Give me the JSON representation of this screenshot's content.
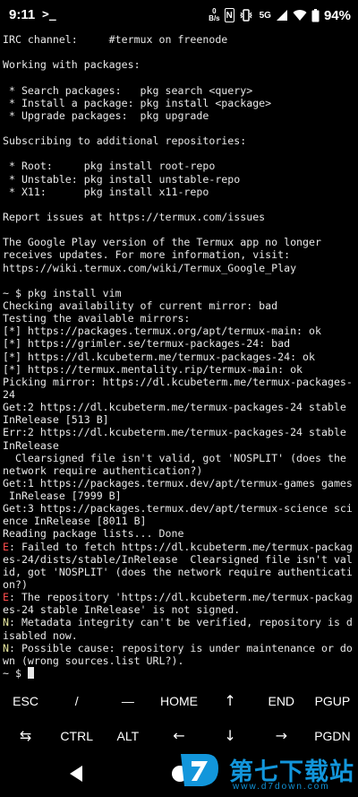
{
  "status_bar": {
    "time": "9:11",
    "terminal_icon": ">_",
    "net_speed_value": "0",
    "net_speed_unit": "B/s",
    "nfc_label": "N",
    "network_label": "5G",
    "battery_text": "94%"
  },
  "terminal": {
    "lines": [
      {
        "text": "IRC channel:     #termux on freenode"
      },
      {
        "text": ""
      },
      {
        "text": "Working with packages:"
      },
      {
        "text": ""
      },
      {
        "text": " * Search packages:   pkg search <query>"
      },
      {
        "text": " * Install a package: pkg install <package>"
      },
      {
        "text": " * Upgrade packages:  pkg upgrade"
      },
      {
        "text": ""
      },
      {
        "text": "Subscribing to additional repositories:"
      },
      {
        "text": ""
      },
      {
        "text": " * Root:     pkg install root-repo"
      },
      {
        "text": " * Unstable: pkg install unstable-repo"
      },
      {
        "text": " * X11:      pkg install x11-repo"
      },
      {
        "text": ""
      },
      {
        "text": "Report issues at https://termux.com/issues"
      },
      {
        "text": ""
      },
      {
        "text": "The Google Play version of the Termux app no longer"
      },
      {
        "text": "receives updates. For more information, visit:"
      },
      {
        "text": "https://wiki.termux.com/wiki/Termux_Google_Play"
      },
      {
        "text": ""
      },
      {
        "text": "~ $ pkg install vim"
      },
      {
        "text": "Checking availability of current mirror: bad"
      },
      {
        "text": "Testing the available mirrors:"
      },
      {
        "text": "[*] https://packages.termux.org/apt/termux-main: ok"
      },
      {
        "text": "[*] https://grimler.se/termux-packages-24: bad"
      },
      {
        "text": "[*] https://dl.kcubeterm.me/termux-packages-24: ok"
      },
      {
        "text": "[*] https://termux.mentality.rip/termux-main: ok"
      },
      {
        "text": "Picking mirror: https://dl.kcubeterm.me/termux-packages-"
      },
      {
        "text": "24"
      },
      {
        "text": "Get:2 https://dl.kcubeterm.me/termux-packages-24 stable"
      },
      {
        "text": "InRelease [513 B]"
      },
      {
        "text": "Err:2 https://dl.kcubeterm.me/termux-packages-24 stable"
      },
      {
        "text": "InRelease"
      },
      {
        "text": "  Clearsigned file isn't valid, got 'NOSPLIT' (does the"
      },
      {
        "text": "network require authentication?)"
      },
      {
        "text": "Get:1 https://packages.termux.dev/apt/termux-games games"
      },
      {
        "text": " InRelease [7999 B]"
      },
      {
        "text": "Get:3 https://packages.termux.dev/apt/termux-science sci"
      },
      {
        "text": "ence InRelease [8011 B]"
      },
      {
        "text": "Reading package lists... Done"
      },
      {
        "prefix": "E",
        "text": ": Failed to fetch https://dl.kcubeterm.me/termux-packag"
      },
      {
        "text": "es-24/dists/stable/InRelease  Clearsigned file isn't val"
      },
      {
        "text": "id, got 'NOSPLIT' (does the network require authenticati"
      },
      {
        "text": "on?)"
      },
      {
        "prefix": "E",
        "text": ": The repository 'https://dl.kcubeterm.me/termux-packag"
      },
      {
        "text": "es-24 stable InRelease' is not signed."
      },
      {
        "prefix": "N",
        "text": ": Metadata integrity can't be verified, repository is d"
      },
      {
        "text": "isabled now."
      },
      {
        "prefix": "N",
        "text": ": Possible cause: repository is under maintenance or do"
      },
      {
        "text": "wn (wrong sources.list URL?)."
      },
      {
        "text": "~ $ ",
        "cursor": true
      }
    ]
  },
  "extra_keys": {
    "row1": [
      "ESC",
      "/",
      "—",
      "HOME",
      "↑",
      "END",
      "PGUP"
    ],
    "row2": [
      "⇆",
      "CTRL",
      "ALT",
      "←",
      "↓",
      "→",
      "PGDN"
    ]
  },
  "watermark": {
    "name": "第七下载站",
    "url": "www.d7down.com"
  },
  "colors": {
    "background": "#000000",
    "terminal_text": "#e8e8e8",
    "error_prefix": "#ff4d4d",
    "notice_prefix": "#e8e8a0",
    "watermark": "#1296db"
  }
}
